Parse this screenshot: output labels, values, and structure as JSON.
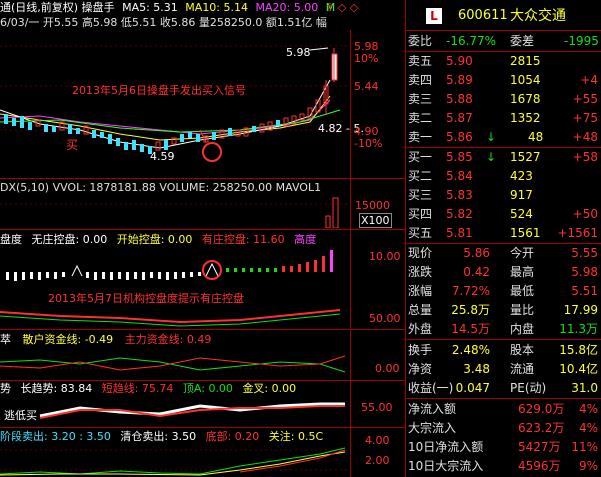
{
  "header": {
    "title": "通(日线,前复权) 操盘手",
    "ma5": "MA5: 5.31",
    "ma10": "MA10: 5.14",
    "ma20": "MA20: 5.00",
    "ma_more": "M",
    "info_line": "6/03/一 开5.55 高5.98 低5.51 收5.86 量258250.0 额1.51亿 幅"
  },
  "main_chart": {
    "annotation_buy": "2013年5月6日操盘手发出买入信号",
    "buy_label": "买",
    "low_label": "4.59",
    "high_label": "5.98",
    "axis_right_label": "4.82 - 5.",
    "y_labels": [
      "5.98",
      "10%",
      "5.44",
      "4.90",
      "-10%"
    ]
  },
  "volume_panel": {
    "header": "DX(5,10) VVOL: 1878181.88 VOLUME: 258250.00 MAVOL1",
    "y_labels": [
      "15000",
      "X100"
    ]
  },
  "control_panel": {
    "title": "盘度",
    "none": "无庄控盘: 0.00",
    "start": "开始控盘: 0.00",
    "has": "有庄控盘: 11.60",
    "high": "高度",
    "annotation": "2013年5月7日机构控盘度提示有庄控盘",
    "y_labels": [
      "10.00",
      "50.00"
    ]
  },
  "fund_panel": {
    "title": "萃",
    "retail": "散户资金线: -0.49",
    "main": "主力资金线: 0.49",
    "y_labels": [
      "0.00"
    ]
  },
  "trend_panel": {
    "title": "势",
    "long": "长趋势: 83.84",
    "short": "短趋线: 75.74",
    "top": "顶A: 0.00",
    "cross": "金叉: 0.00",
    "extra": "逃低买",
    "y_labels": [
      "55.00"
    ]
  },
  "stage_panel": {
    "sell": "阶段卖出: 3.20 : 3.50",
    "clear": "清仓卖出: 3.50",
    "bottom": "底部: 0.20",
    "watch": "关注: 0.5C",
    "y_labels": [
      "4.00",
      "2.00"
    ]
  },
  "quote": {
    "badge": "L",
    "code": "600611",
    "name": "大众交通",
    "weibi_label": "委比",
    "weibi": "-16.77%",
    "weicha_label": "委差",
    "weicha": "-1995",
    "sells": [
      {
        "label": "卖五",
        "price": "5.90",
        "vol": "2815",
        "chg": ""
      },
      {
        "label": "卖四",
        "price": "5.89",
        "vol": "1054",
        "chg": "+4"
      },
      {
        "label": "卖三",
        "price": "5.88",
        "vol": "1678",
        "chg": "+55"
      },
      {
        "label": "卖二",
        "price": "5.87",
        "vol": "1352",
        "chg": "+75"
      },
      {
        "label": "卖一",
        "price": "5.86",
        "vol": "48",
        "chg": "+48",
        "arrow": "↓"
      }
    ],
    "buys": [
      {
        "label": "买一",
        "price": "5.85",
        "vol": "1527",
        "chg": "+58",
        "arrow": "↓"
      },
      {
        "label": "买二",
        "price": "5.84",
        "vol": "423",
        "chg": ""
      },
      {
        "label": "买三",
        "price": "5.83",
        "vol": "917",
        "chg": ""
      },
      {
        "label": "买四",
        "price": "5.82",
        "vol": "524",
        "chg": "+50"
      },
      {
        "label": "买五",
        "price": "5.81",
        "vol": "1561",
        "chg": "+1561"
      }
    ],
    "stats": [
      {
        "l1": "现价",
        "v1": "5.86",
        "l2": "今开",
        "v2": "5.55"
      },
      {
        "l1": "涨跌",
        "v1": "0.42",
        "l2": "最高",
        "v2": "5.98"
      },
      {
        "l1": "涨幅",
        "v1": "7.72%",
        "l2": "最低",
        "v2": "5.51"
      },
      {
        "l1": "总量",
        "v1": "25.8万",
        "l2": "量比",
        "v2": "17.99"
      },
      {
        "l1": "外盘",
        "v1": "14.5万",
        "l2": "内盘",
        "v2": "11.3万"
      }
    ],
    "stats2": [
      {
        "l1": "换手",
        "v1": "2.48%",
        "l2": "股本",
        "v2": "15.8亿"
      },
      {
        "l1": "净资",
        "v1": "3.48",
        "l2": "流通",
        "v2": "10.4亿"
      },
      {
        "l1": "收益(一)",
        "v1": "0.047",
        "l2": "PE(动)",
        "v2": "31.0"
      }
    ],
    "flows": [
      {
        "label": "净流入额",
        "value": "629.0万",
        "pct": "4%"
      },
      {
        "label": "大宗流入",
        "value": "623.2万",
        "pct": "4%"
      },
      {
        "label": "10日净流入额",
        "value": "5427万",
        "pct": "11%"
      },
      {
        "label": "10日大宗流入",
        "value": "4596万",
        "pct": "9%"
      }
    ]
  },
  "colors": {
    "up": "#ff3030",
    "down": "#10e010",
    "accent": "#ffff30",
    "border": "#a00000",
    "cyan": "#40e0ff"
  }
}
